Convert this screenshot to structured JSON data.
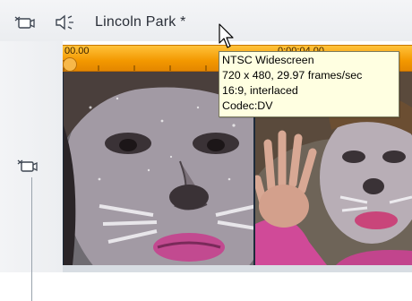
{
  "header": {
    "video_icon": "video-track-icon",
    "audio_icon": "audio-speaker-icon",
    "title": "Lincoln Park *"
  },
  "timeline": {
    "timecode_start": "00.00",
    "timecode_next": "0:00:04.00"
  },
  "left_panel": {
    "track_icon": "track-video-icon"
  },
  "tooltip": {
    "line1": "NTSC Widescreen",
    "line2": "720 x 480, 29.97 frames/sec",
    "line3": "16:9, interlaced",
    "line4": "Codec:DV"
  },
  "colors": {
    "ruler_orange": "#f39800",
    "tooltip_bg": "#ffffe1",
    "clip_border": "#1d2a3a"
  }
}
